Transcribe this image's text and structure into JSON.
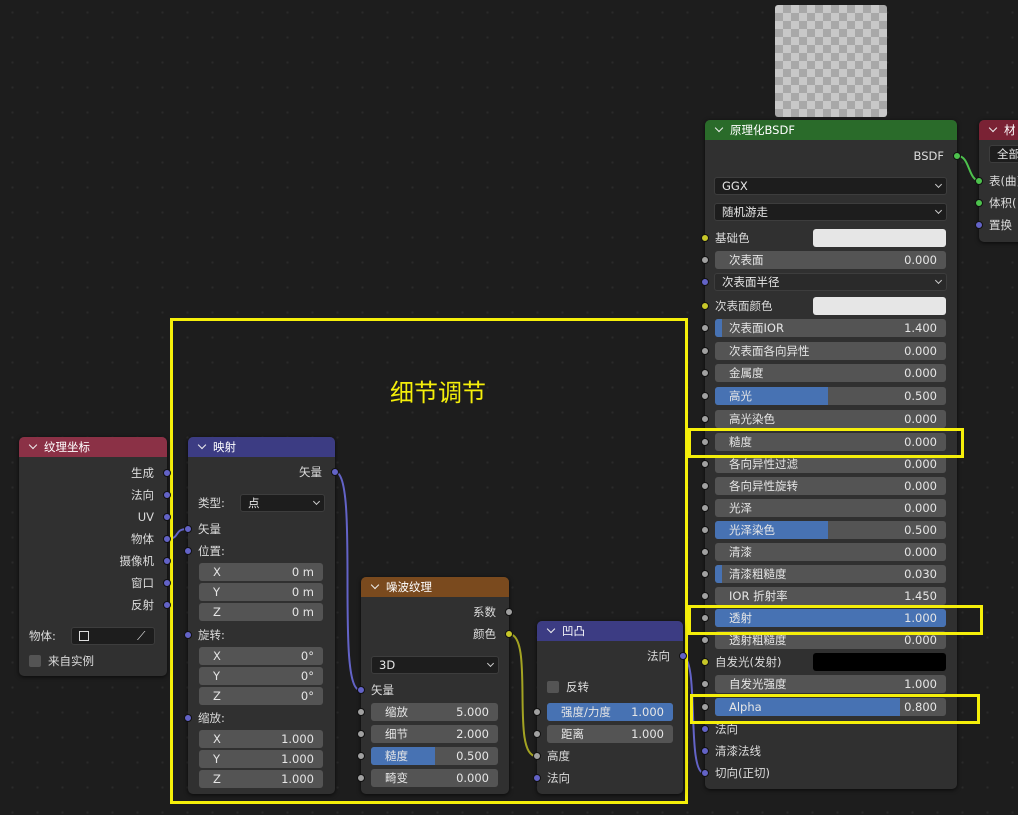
{
  "nodes": {
    "texcoord": {
      "title": "纹理坐标",
      "header_color": "#8b3146",
      "outputs": [
        "生成",
        "法向",
        "UV",
        "物体",
        "摄像机",
        "窗口",
        "反射"
      ],
      "object_label": "物体:",
      "from_instancer": "来自实例"
    },
    "mapping": {
      "title": "映射",
      "header_color": "#3c3c83",
      "output": "矢量",
      "type_label": "类型:",
      "type_value": "点",
      "vector_label": "矢量",
      "location_label": "位置:",
      "rotation_label": "旋转:",
      "scale_label": "缩放:",
      "location": [
        {
          "axis": "X",
          "value": "0 m"
        },
        {
          "axis": "Y",
          "value": "0 m"
        },
        {
          "axis": "Z",
          "value": "0 m"
        }
      ],
      "rotation": [
        {
          "axis": "X",
          "value": "0°"
        },
        {
          "axis": "Y",
          "value": "0°"
        },
        {
          "axis": "Z",
          "value": "0°"
        }
      ],
      "scale": [
        {
          "axis": "X",
          "value": "1.000"
        },
        {
          "axis": "Y",
          "value": "1.000"
        },
        {
          "axis": "Z",
          "value": "1.000"
        }
      ]
    },
    "noise": {
      "title": "噪波纹理",
      "header_color": "#7a4a1e",
      "outputs": [
        "系数",
        "颜色"
      ],
      "dimension": "3D",
      "vector_label": "矢量",
      "fields": [
        {
          "label": "缩放",
          "value": "5.000",
          "fill": 0
        },
        {
          "label": "细节",
          "value": "2.000",
          "fill": 0
        },
        {
          "label": "糙度",
          "value": "0.500",
          "fill": 0.5
        },
        {
          "label": "畸变",
          "value": "0.000",
          "fill": 0
        }
      ]
    },
    "bump": {
      "title": "凹凸",
      "header_color": "#3c3c83",
      "output": "法向",
      "invert_label": "反转",
      "fields": [
        {
          "label": "强度/力度",
          "value": "1.000",
          "fill": 1
        },
        {
          "label": "距离",
          "value": "1.000",
          "fill": 0
        }
      ],
      "inputs": [
        "高度",
        "法向"
      ]
    },
    "bsdf": {
      "title": "原理化BSDF",
      "header_color": "#2a6b2a",
      "output": "BSDF",
      "distribution": "GGX",
      "subsurface_method": "随机游走",
      "base_color_label": "基础色",
      "base_color": "#e6e6e6",
      "subsurface": {
        "label": "次表面",
        "value": "0.000"
      },
      "subsurface_radius": "次表面半径",
      "subsurface_color_label": "次表面颜色",
      "subsurface_color": "#e6e6e6",
      "fields": [
        {
          "label": "次表面IOR",
          "value": "1.400",
          "fill": 0.03
        },
        {
          "label": "次表面各向异性",
          "value": "0.000",
          "fill": 0
        },
        {
          "label": "金属度",
          "value": "0.000",
          "fill": 0
        },
        {
          "label": "高光",
          "value": "0.500",
          "fill": 0.5
        },
        {
          "label": "高光染色",
          "value": "0.000",
          "fill": 0
        },
        {
          "label": "糙度",
          "value": "0.000",
          "fill": 0
        },
        {
          "label": "各向异性过滤",
          "value": "0.000",
          "fill": 0
        },
        {
          "label": "各向异性旋转",
          "value": "0.000",
          "fill": 0
        },
        {
          "label": "光泽",
          "value": "0.000",
          "fill": 0
        },
        {
          "label": "光泽染色",
          "value": "0.500",
          "fill": 0.5
        },
        {
          "label": "清漆",
          "value": "0.000",
          "fill": 0
        },
        {
          "label": "清漆粗糙度",
          "value": "0.030",
          "fill": 0.03
        },
        {
          "label": "IOR 折射率",
          "value": "1.450",
          "fill": 0
        },
        {
          "label": "透射",
          "value": "1.000",
          "fill": 1
        },
        {
          "label": "透射粗糙度",
          "value": "0.000",
          "fill": 0
        }
      ],
      "emission_label": "自发光(发射)",
      "emission_color": "#000000",
      "emission_strength": {
        "label": "自发光强度",
        "value": "1.000"
      },
      "alpha": {
        "label": "Alpha",
        "value": "0.800",
        "fill": 0.8
      },
      "vector_inputs": [
        "法向",
        "清漆法线",
        "切向(正切)"
      ]
    },
    "output": {
      "title": "材",
      "header_color": "#7a2234",
      "target": "全部",
      "inputs": [
        "表(曲)",
        "体积(",
        "置换"
      ]
    }
  },
  "frame": {
    "title": "细节调节"
  },
  "highlight_color": "#f5ef0a"
}
